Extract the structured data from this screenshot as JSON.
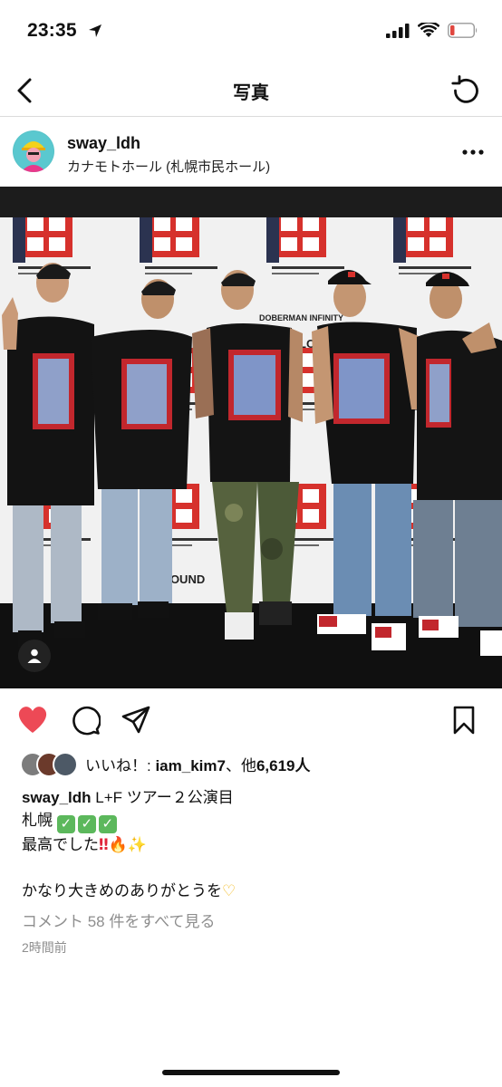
{
  "status": {
    "time": "23:35"
  },
  "nav": {
    "title": "写真"
  },
  "post": {
    "username": "sway_ldh",
    "location": "カナモトホール (札幌市民ホール)",
    "photo": {
      "banner_text_1": "DOBERMAN INFINITY",
      "banner_text_2": "LOST",
      "banner_text_3": "FOUND"
    },
    "likes": {
      "prefix": "いいね！: ",
      "user": "iam_kim7",
      "middle": "、他",
      "count": "6,619",
      "suffix": "人"
    },
    "caption": {
      "username": "sway_ldh",
      "line1": " L+F ツアー２公演目",
      "line2": "札幌 ",
      "line3": "最高でした",
      "line4": "かなり大きめのありがとうを"
    },
    "view_comments": "コメント 58 件をすべて見る",
    "time_ago": "2時間前"
  },
  "colors": {
    "like_red": "#ed4956",
    "muted": "#8e8e8e",
    "battery_red": "#e0473f"
  }
}
